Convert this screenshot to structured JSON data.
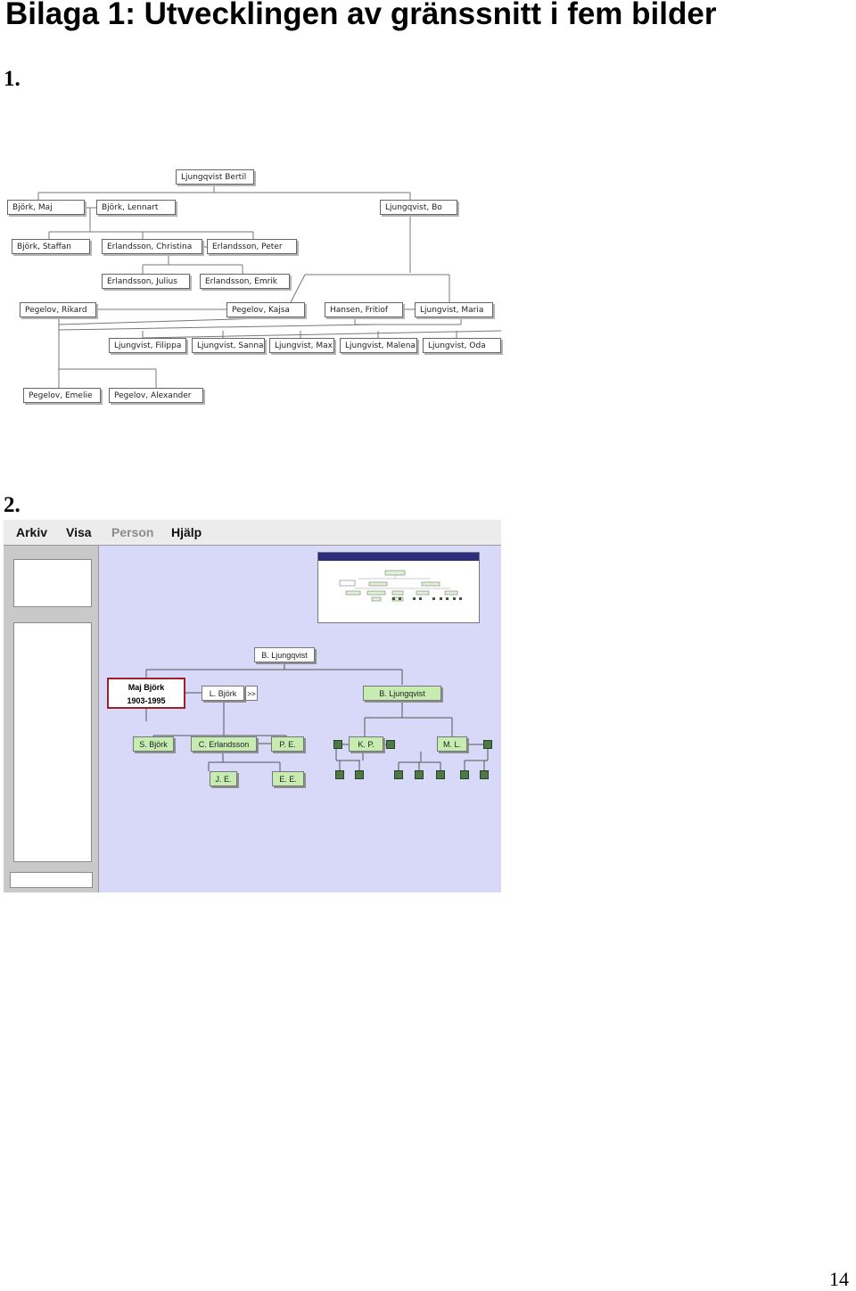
{
  "page": {
    "title": "Bilaga 1: Utvecklingen av gränssnitt i fem bilder",
    "figure1_label": "1.",
    "figure2_label": "2.",
    "page_number": "14"
  },
  "figure1": {
    "nodes": [
      "Ljungqvist Bertil",
      "Björk, Maj",
      "Björk, Lennart",
      "Ljungqvist, Bo",
      "Björk, Staffan",
      "Erlandsson, Christina",
      "Erlandsson, Peter",
      "Erlandsson, Julius",
      "Erlandsson, Emrik",
      "Pegelov, Rikard",
      "Pegelov, Kajsa",
      "Hansen, Fritiof",
      "Ljungvist, Maria",
      "Ljungvist, Filippa",
      "Ljungvist, Sanna",
      "Ljungvist, Max",
      "Ljungvist, Malena",
      "Ljungvist, Oda",
      "Pegelov, Emelie",
      "Pegelov, Alexander"
    ]
  },
  "figure2": {
    "menu": {
      "arkiv": "Arkiv",
      "visa": "Visa",
      "person": "Person",
      "hjalp": "Hjälp"
    },
    "selected": {
      "name": "Maj Björk",
      "years": "1903-1995"
    },
    "nodes": {
      "root": "B. Ljungqvist",
      "l_bjork": "L. Björk",
      "expand": ">>",
      "b_ljungqvist": "B. Ljungqvist",
      "s_bjork": "S. Björk",
      "c_erlandsson": "C. Erlandsson",
      "pe": "P. E.",
      "kp": "K. P.",
      "ml": "M. L.",
      "je": "J. E.",
      "ee": "E. E."
    },
    "colors": {
      "canvas": "#d8d8f8",
      "node_green": "#c7ecb2",
      "leaf_square": "#4b7a45",
      "selection_border": "#a0202a"
    }
  }
}
